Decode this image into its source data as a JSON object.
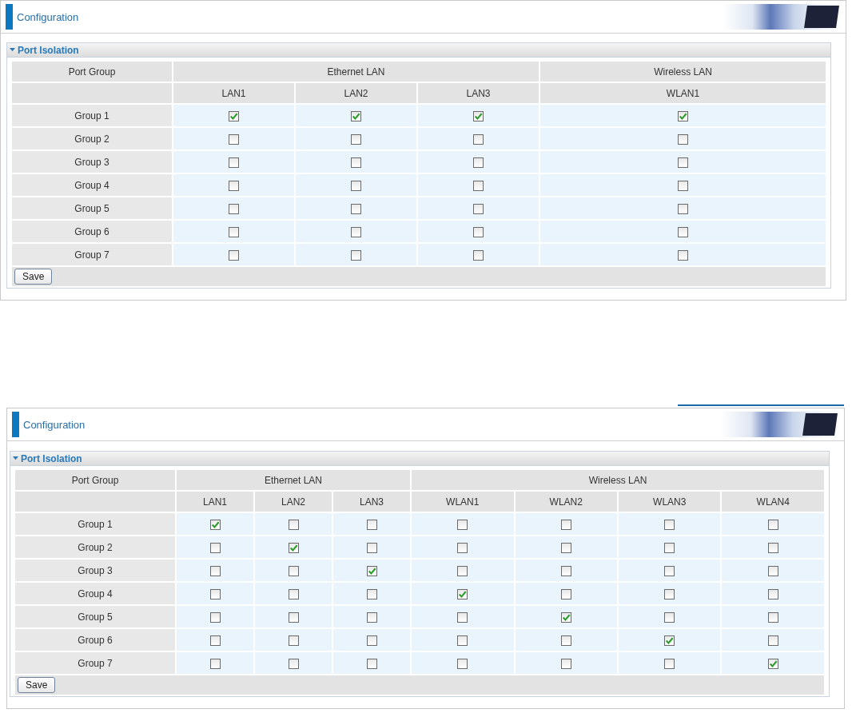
{
  "panels": [
    {
      "title": "Configuration",
      "section": {
        "title": "Port Isolation",
        "expanded": true
      },
      "header_groups": [
        {
          "label": "Port Group"
        },
        {
          "label": "Ethernet LAN",
          "ports": [
            "LAN1",
            "LAN2",
            "LAN3"
          ]
        },
        {
          "label": "Wireless LAN",
          "ports": [
            "WLAN1"
          ]
        }
      ],
      "rows": [
        {
          "label": "Group 1",
          "checks": [
            true,
            true,
            true,
            true
          ]
        },
        {
          "label": "Group 2",
          "checks": [
            false,
            false,
            false,
            false
          ]
        },
        {
          "label": "Group 3",
          "checks": [
            false,
            false,
            false,
            false
          ]
        },
        {
          "label": "Group 4",
          "checks": [
            false,
            false,
            false,
            false
          ]
        },
        {
          "label": "Group 5",
          "checks": [
            false,
            false,
            false,
            false
          ]
        },
        {
          "label": "Group 6",
          "checks": [
            false,
            false,
            false,
            false
          ]
        },
        {
          "label": "Group 7",
          "checks": [
            false,
            false,
            false,
            false
          ]
        }
      ],
      "button": "Save"
    },
    {
      "title": "Configuration",
      "section": {
        "title": "Port Isolation",
        "expanded": true
      },
      "header_groups": [
        {
          "label": "Port Group"
        },
        {
          "label": "Ethernet LAN",
          "ports": [
            "LAN1",
            "LAN2",
            "LAN3"
          ]
        },
        {
          "label": "Wireless LAN",
          "ports": [
            "WLAN1",
            "WLAN2",
            "WLAN3",
            "WLAN4"
          ]
        }
      ],
      "rows": [
        {
          "label": "Group 1",
          "checks": [
            true,
            false,
            false,
            false,
            false,
            false,
            false
          ]
        },
        {
          "label": "Group 2",
          "checks": [
            false,
            true,
            false,
            false,
            false,
            false,
            false
          ]
        },
        {
          "label": "Group 3",
          "checks": [
            false,
            false,
            true,
            false,
            false,
            false,
            false
          ]
        },
        {
          "label": "Group 4",
          "checks": [
            false,
            false,
            false,
            true,
            false,
            false,
            false
          ]
        },
        {
          "label": "Group 5",
          "checks": [
            false,
            false,
            false,
            false,
            true,
            false,
            false
          ]
        },
        {
          "label": "Group 6",
          "checks": [
            false,
            false,
            false,
            false,
            false,
            true,
            false
          ]
        },
        {
          "label": "Group 7",
          "checks": [
            false,
            false,
            false,
            false,
            false,
            false,
            true
          ]
        }
      ],
      "button": "Save"
    }
  ]
}
